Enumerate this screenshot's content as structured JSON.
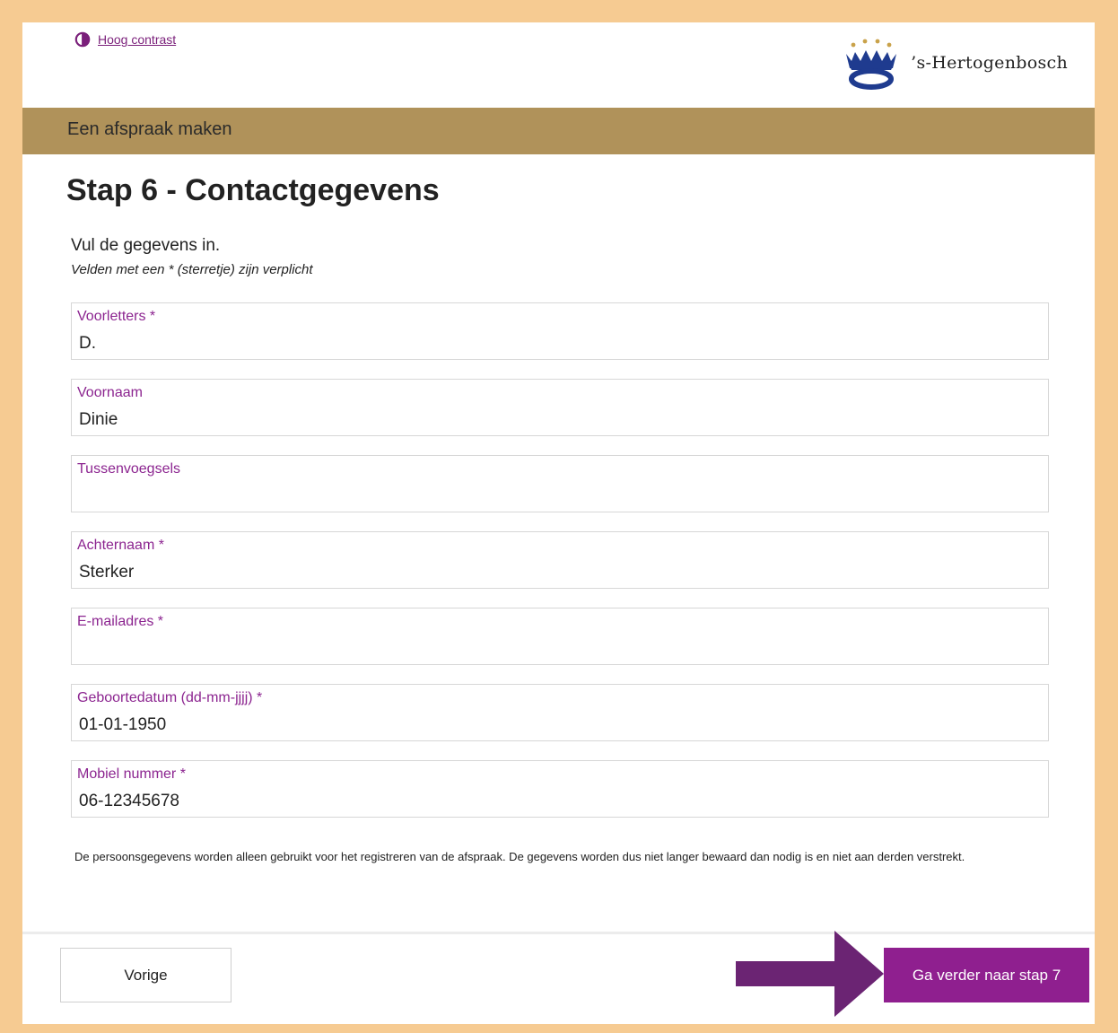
{
  "header": {
    "contrast_link": "Hoog contrast",
    "logo_text": "’s-Hertogenbosch"
  },
  "band": {
    "title": "Een afspraak maken"
  },
  "page": {
    "title": "Stap 6 - Contactgegevens",
    "intro": "Vul de gegevens in.",
    "required_note": "Velden met een * (sterretje) zijn verplicht"
  },
  "form": {
    "fields": [
      {
        "label": "Voorletters *",
        "value": "D."
      },
      {
        "label": "Voornaam",
        "value": "Dinie"
      },
      {
        "label": "Tussenvoegsels",
        "value": ""
      },
      {
        "label": "Achternaam *",
        "value": "Sterker"
      },
      {
        "label": "E-mailadres *",
        "value": ""
      },
      {
        "label": "Geboortedatum (dd-mm-jjjj) *",
        "value": "01-01-1950"
      },
      {
        "label": "Mobiel nummer *",
        "value": "06-12345678"
      }
    ]
  },
  "privacy_text": "De persoonsgegevens worden alleen gebruikt voor het registreren van de afspraak. De gegevens worden dus niet langer bewaard dan nodig is en niet aan derden verstrekt.",
  "footer": {
    "prev_label": "Vorige",
    "next_label": "Ga verder naar stap 7"
  },
  "colors": {
    "page_border": "#f6cb92",
    "band": "#b0925a",
    "accent": "#8f1f8f",
    "arrow": "#6b2473"
  },
  "icons": {
    "contrast": "half-circle-contrast-icon",
    "logo": "crown-logo-icon",
    "arrow": "right-arrow-annotation"
  }
}
